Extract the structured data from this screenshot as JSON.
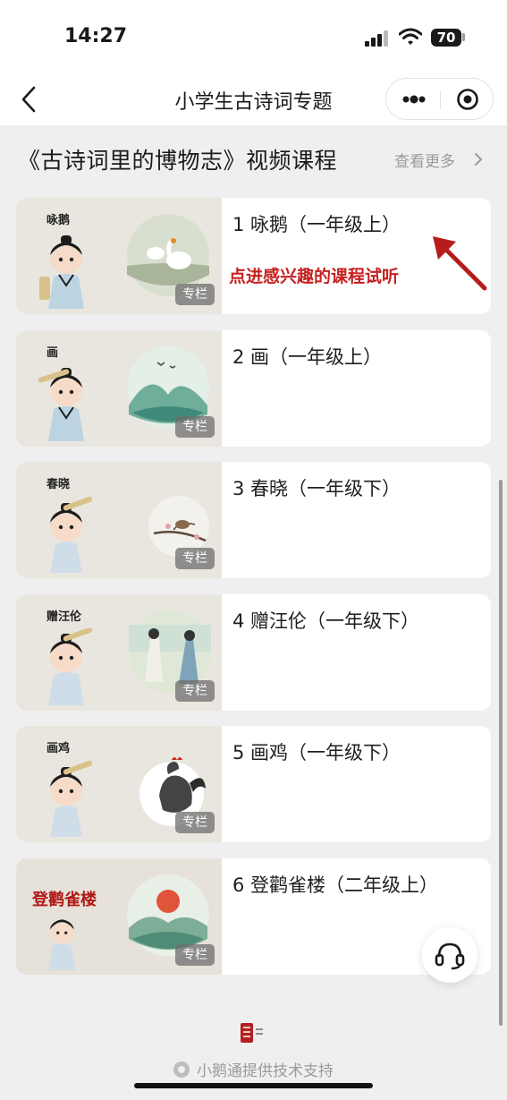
{
  "status_bar": {
    "time": "14:27",
    "battery": "70"
  },
  "nav": {
    "title": "小学生古诗词专题"
  },
  "section": {
    "title": "《古诗词里的博物志》视频课程",
    "more_label": "查看更多"
  },
  "hint": {
    "text": "点进感兴趣的课程试听",
    "color": "#c62020"
  },
  "courses": [
    {
      "title": "1 咏鹅（一年级上）",
      "thumb_label": "咏鹅",
      "badge": "专栏",
      "scene": "geese"
    },
    {
      "title": "2 画（一年级上）",
      "thumb_label": "画",
      "badge": "专栏",
      "scene": "mountains"
    },
    {
      "title": "3 春晓（一年级下）",
      "thumb_label": "春晓",
      "badge": "专栏",
      "scene": "bird-branch"
    },
    {
      "title": "4 赠汪伦（一年级下）",
      "thumb_label": "赠汪伦",
      "badge": "专栏",
      "scene": "two-men"
    },
    {
      "title": "5 画鸡（一年级下）",
      "thumb_label": "画鸡",
      "badge": "专栏",
      "scene": "rooster"
    },
    {
      "title": "6 登鹳雀楼（二年级上）",
      "thumb_label": "登鹳雀楼",
      "badge": "专栏",
      "scene": "sunset-mountains"
    }
  ],
  "footer": {
    "text": "小鹅通提供技术支持"
  }
}
